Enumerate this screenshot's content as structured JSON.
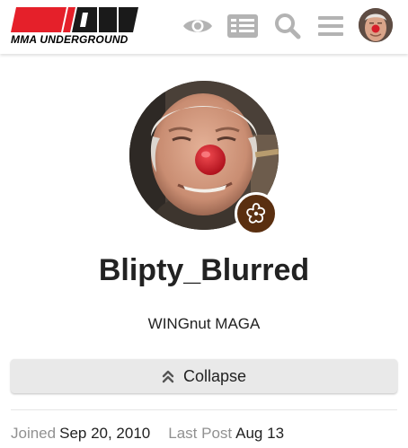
{
  "header": {
    "logo_text": "MMA UNDERGROUND",
    "icons": [
      "eye-icon",
      "list-icon",
      "search-icon",
      "hamburger-icon"
    ],
    "colors": {
      "logo_red": "#e5202a",
      "logo_black": "#1a1a1a",
      "icon_gray": "#b3b3b3"
    }
  },
  "profile": {
    "username": "Blipty_Blurred",
    "title": "WINGnut MAGA",
    "collapse_label": "Collapse",
    "flair_color": "#5a2f10"
  },
  "stats": {
    "joined_label": "Joined",
    "joined_value": "Sep 20, 2010",
    "last_post_label": "Last Post",
    "last_post_value": "Aug 13"
  }
}
